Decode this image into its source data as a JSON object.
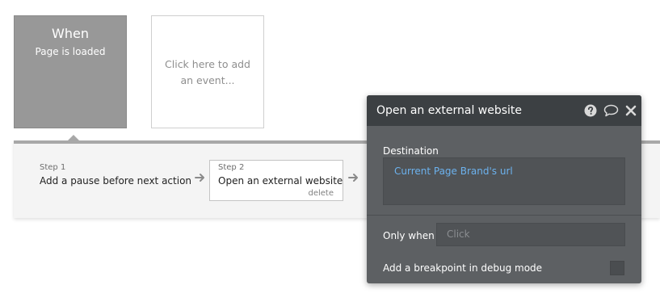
{
  "events": {
    "when_title": "When",
    "when_subtitle": "Page is loaded",
    "add_event_text": "Click here to add an event..."
  },
  "steps": [
    {
      "number": "Step 1",
      "title": "Add a pause before next action"
    },
    {
      "number": "Step 2",
      "title": "Open an external website",
      "delete_label": "delete"
    }
  ],
  "popup": {
    "title": "Open an external website",
    "destination_label": "Destination",
    "destination_value": "Current Page Brand's url",
    "only_when_label": "Only when",
    "only_when_placeholder": "Click",
    "breakpoint_label": "Add a breakpoint in debug mode",
    "breakpoint_checked": false,
    "icons": [
      "help-icon",
      "comment-icon",
      "close-icon"
    ]
  },
  "colors": {
    "link_blue": "#6cb2ee",
    "popup_bg": "#5d6063",
    "popup_header": "#3c4043",
    "event_card": "#989898"
  }
}
